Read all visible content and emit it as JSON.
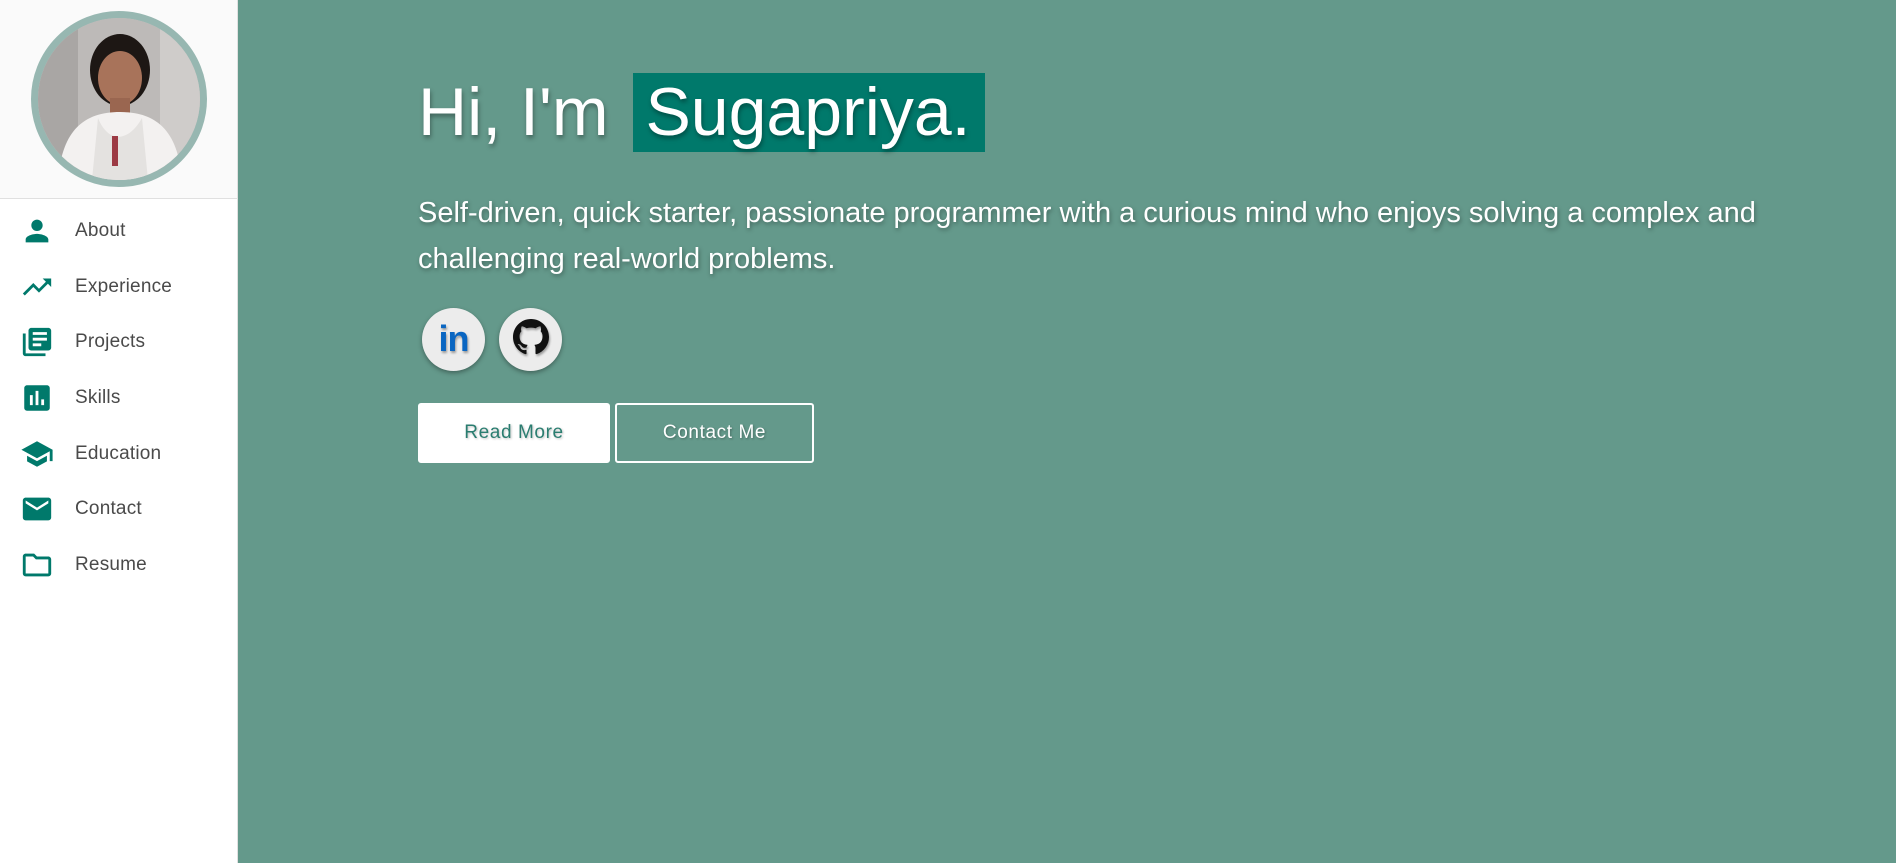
{
  "sidebar": {
    "avatar_icon": "profile-photo",
    "items": [
      {
        "label": "About",
        "icon": "person-icon"
      },
      {
        "label": "Experience",
        "icon": "trending-up-icon"
      },
      {
        "label": "Projects",
        "icon": "library-books-icon"
      },
      {
        "label": "Skills",
        "icon": "bar-chart-icon"
      },
      {
        "label": "Education",
        "icon": "school-icon"
      },
      {
        "label": "Contact",
        "icon": "mail-icon"
      },
      {
        "label": "Resume",
        "icon": "folder-icon"
      }
    ]
  },
  "hero": {
    "greeting_prefix": "Hi, I'm",
    "name": "Sugapriya.",
    "tagline": "Self-driven, quick starter, passionate programmer with a curious mind who enjoys solving a complex and challenging real-world problems.",
    "socials": [
      {
        "icon": "linkedin-icon",
        "glyph": "in"
      },
      {
        "icon": "github-icon"
      }
    ],
    "read_more_label": "Read More",
    "contact_label": "Contact Me"
  },
  "colors": {
    "accent": "#00796b",
    "main_background": "#64998b",
    "avatar_border": "#97b7b1",
    "linkedin_blue": "#0a66c2"
  }
}
